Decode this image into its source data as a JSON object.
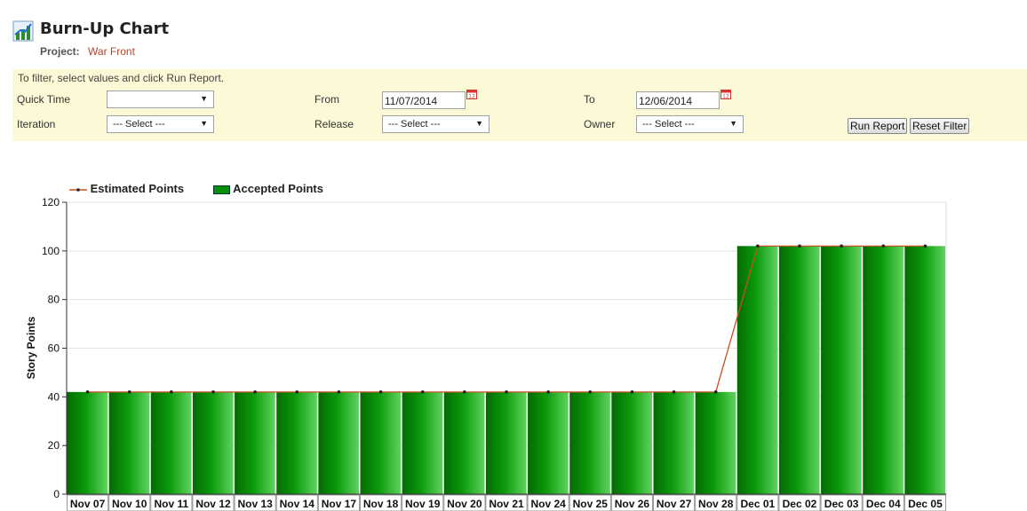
{
  "header": {
    "title": "Burn-Up Chart",
    "project_label": "Project:",
    "project_name": "War Front"
  },
  "filters": {
    "hint": "To filter, select values and click Run Report.",
    "quick_time_label": "Quick Time",
    "quick_time_value": "",
    "from_label": "From",
    "from_value": "11/07/2014",
    "to_label": "To",
    "to_value": "12/06/2014",
    "iteration_label": "Iteration",
    "iteration_value": "--- Select ---",
    "release_label": "Release",
    "release_value": "--- Select ---",
    "owner_label": "Owner",
    "owner_value": "--- Select ---",
    "run_report_label": "Run Report",
    "reset_filter_label": "Reset Filter",
    "icons": [
      "chart-icon",
      "calendar-icon",
      "dropdown-arrow-icon"
    ]
  },
  "chart_data": {
    "type": "bar",
    "title": "",
    "ylabel": "Story Points",
    "xlabel": "",
    "ylim": [
      0,
      120
    ],
    "yticks": [
      0,
      20,
      40,
      60,
      80,
      100,
      120
    ],
    "grid": true,
    "legend_position": "top-left",
    "categories": [
      "Nov 07",
      "Nov 10",
      "Nov 11",
      "Nov 12",
      "Nov 13",
      "Nov 14",
      "Nov 17",
      "Nov 18",
      "Nov 19",
      "Nov 20",
      "Nov 21",
      "Nov 24",
      "Nov 25",
      "Nov 26",
      "Nov 27",
      "Nov 28",
      "Dec 01",
      "Dec 02",
      "Dec 03",
      "Dec 04",
      "Dec 05"
    ],
    "series": [
      {
        "name": "Estimated Points",
        "kind": "line",
        "color": "#c8501e",
        "values": [
          42,
          42,
          42,
          42,
          42,
          42,
          42,
          42,
          42,
          42,
          42,
          42,
          42,
          42,
          42,
          42,
          102,
          102,
          102,
          102,
          102
        ]
      },
      {
        "name": "Accepted Points",
        "kind": "bar",
        "color": "#089108",
        "values": [
          42,
          42,
          42,
          42,
          42,
          42,
          42,
          42,
          42,
          42,
          42,
          42,
          42,
          42,
          42,
          42,
          102,
          102,
          102,
          102,
          102
        ]
      }
    ]
  }
}
